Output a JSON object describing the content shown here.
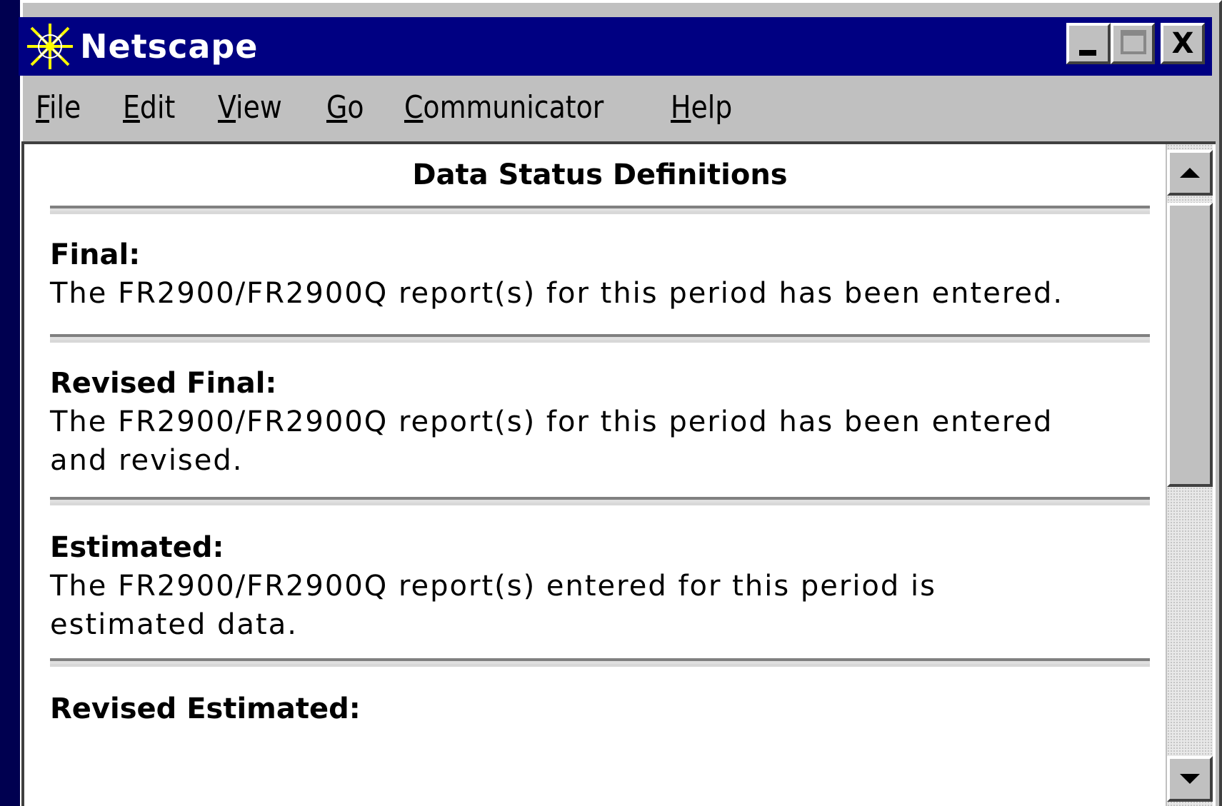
{
  "window": {
    "title": "Netscape",
    "icon": "netscape-logo-icon",
    "controls": {
      "minimize_icon": "minimize-icon",
      "maximize_icon": "maximize-icon",
      "close_icon": "close-icon",
      "close_glyph": "X"
    },
    "colors": {
      "titlebar": "#000082",
      "chrome": "#c0c0c0",
      "content": "#ffffff"
    }
  },
  "menu": [
    {
      "mnemonic": "F",
      "rest": "ile"
    },
    {
      "mnemonic": "E",
      "rest": "dit"
    },
    {
      "mnemonic": "V",
      "rest": "iew"
    },
    {
      "mnemonic": "G",
      "rest": "o"
    },
    {
      "mnemonic": "C",
      "rest": "ommunicator"
    },
    {
      "mnemonic": "H",
      "rest": "elp"
    }
  ],
  "document": {
    "title": "Data Status Definitions",
    "definitions": [
      {
        "term": "Final:",
        "lines": [
          "The FR2900/FR2900Q report(s) for this period has been entered."
        ]
      },
      {
        "term": "Revised Final:",
        "lines": [
          "The FR2900/FR2900Q report(s) for this period has been entered",
          "and revised."
        ]
      },
      {
        "term": "Estimated:",
        "lines": [
          "The FR2900/FR2900Q report(s) entered for this period is",
          "estimated data."
        ]
      },
      {
        "term": "Revised Estimated:",
        "lines": []
      }
    ]
  },
  "scrollbar": {
    "up_icon": "scroll-up-arrow-icon",
    "down_icon": "scroll-down-arrow-icon",
    "position_fraction": 0.0
  }
}
